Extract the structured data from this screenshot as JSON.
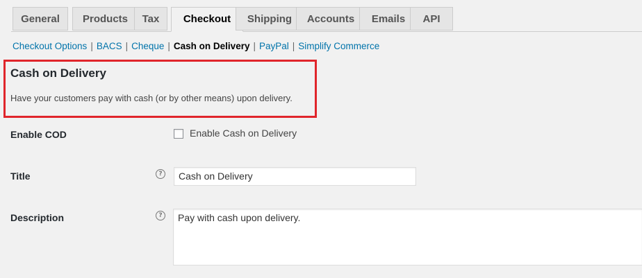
{
  "tabs": [
    {
      "label": "General",
      "active": false
    },
    {
      "label": "Products",
      "active": false
    },
    {
      "label": "Tax",
      "active": false
    },
    {
      "label": "Checkout",
      "active": true
    },
    {
      "label": "Shipping",
      "active": false
    },
    {
      "label": "Accounts",
      "active": false
    },
    {
      "label": "Emails",
      "active": false
    },
    {
      "label": "API",
      "active": false
    }
  ],
  "subnav": {
    "items": [
      "Checkout Options",
      "BACS",
      "Cheque",
      "Cash on Delivery",
      "PayPal",
      "Simplify Commerce"
    ],
    "current": "Cash on Delivery",
    "separator": "|"
  },
  "section": {
    "title": "Cash on Delivery",
    "description": "Have your customers pay with cash (or by other means) upon delivery."
  },
  "form": {
    "enable": {
      "label": "Enable COD",
      "checkbox_label": "Enable Cash on Delivery",
      "checked": false
    },
    "title": {
      "label": "Title",
      "help_glyph": "?",
      "value": "Cash on Delivery"
    },
    "description": {
      "label": "Description",
      "help_glyph": "?",
      "value": "Pay with cash upon delivery."
    }
  },
  "colors": {
    "highlight": "#e0252b",
    "link": "#0073aa"
  }
}
